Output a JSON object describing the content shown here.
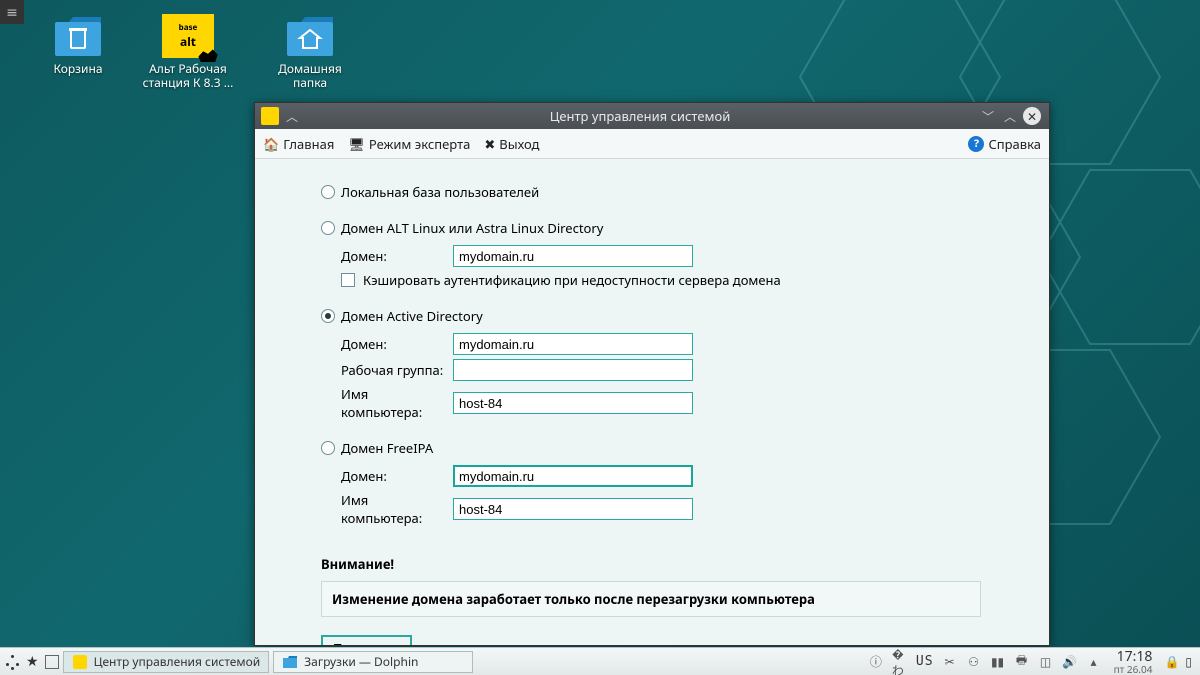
{
  "desktop_icons": {
    "trash": "Корзина",
    "alt": "Альт Рабочая станция К 8.3  ...",
    "home": "Домашняя папка"
  },
  "window": {
    "title": "Центр управления системой",
    "toolbar": {
      "main": "Главная",
      "expert": "Режим эксперта",
      "exit": "Выход",
      "help": "Справка"
    },
    "form": {
      "opt_local": "Локальная база пользователей",
      "opt_altlinux": "Домен ALT Linux или Astra Linux Directory",
      "alt_domain_label": "Домен:",
      "alt_domain_value": "mydomain.ru",
      "cache_auth": "Кэшировать аутентификацию при недоступности сервера домена",
      "opt_ad": "Домен Active Directory",
      "ad_domain_label": "Домен:",
      "ad_domain_value": "mydomain.ru",
      "ad_workgroup_label": "Рабочая группа:",
      "ad_workgroup_value": "",
      "ad_host_label": "Имя компьютера:",
      "ad_host_value": "host-84",
      "opt_freeipa": "Домен FreeIPA",
      "ipa_domain_label": "Домен:",
      "ipa_domain_value": "mydomain.ru",
      "ipa_host_label": "Имя компьютера:",
      "ipa_host_value": "host-84",
      "attention": "Внимание!",
      "notice": "Изменение домена заработает только после перезагрузки компьютера",
      "apply": "Применить"
    }
  },
  "taskbar": {
    "task1": "Центр управления системой",
    "task2": "Загрузки — Dolphin",
    "lang": "US",
    "time": "17:18",
    "date": "пт 26.04"
  }
}
